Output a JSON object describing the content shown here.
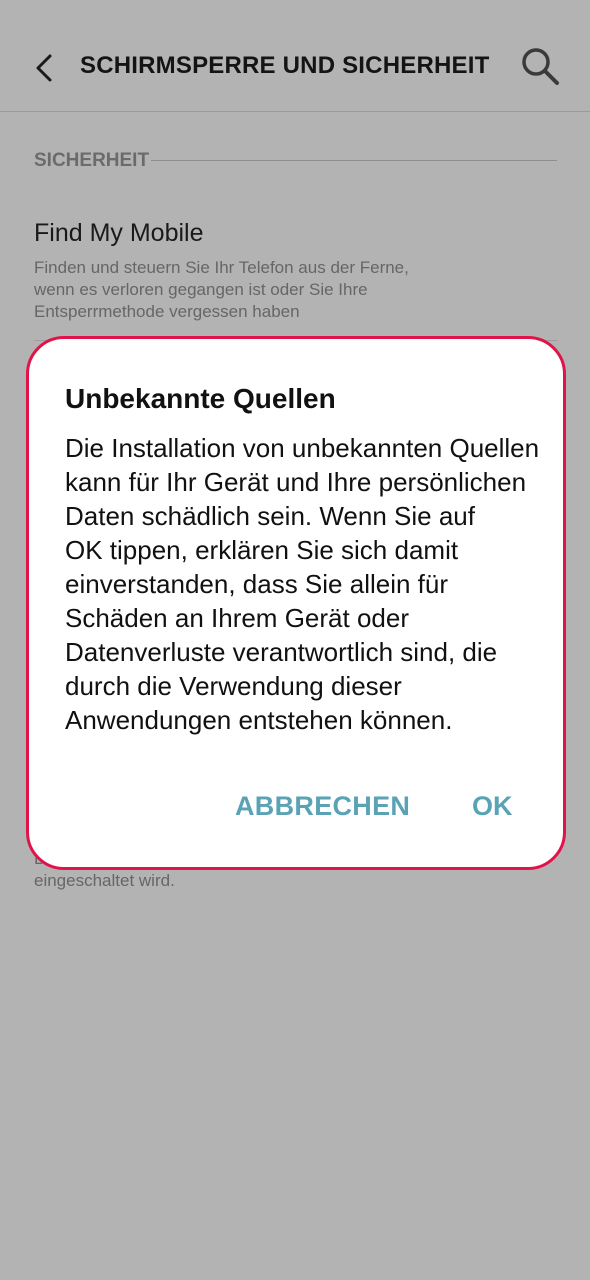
{
  "app_bar": {
    "back_icon": "back-arrow-icon",
    "title": "SCHIRMSPERRE UND SICHERHEIT",
    "search_icon": "search-icon"
  },
  "section": {
    "title": "SICHERHEIT"
  },
  "find_my_mobile": {
    "title": "Find My Mobile",
    "summary": "Finden und steuern Sie Ihr Telefon aus der Ferne, wenn es verloren gegangen ist oder Sie Ihre Entsperrmethode vergessen haben"
  },
  "background_text": {
    "partial": "B\neingeschaltet wird."
  },
  "dialog": {
    "title": "Unbekannte Quellen",
    "message": "Die Installation von unbekannten Quellen kann für Ihr Gerät und Ihre persönlichen Daten schädlich sein. Wenn Sie auf\nOK tippen, erklären Sie sich damit einverstanden, dass Sie allein für Schäden an Ihrem Gerät oder Datenverluste verantwortlich sind, die durch die Verwendung dieser Anwendungen entstehen können.",
    "cancel_label": "ABBRECHEN",
    "ok_label": "OK"
  },
  "colors": {
    "scrim_background": "#b3b3b3",
    "dialog_border": "#e0144a",
    "button_text": "#5aa3b5"
  }
}
